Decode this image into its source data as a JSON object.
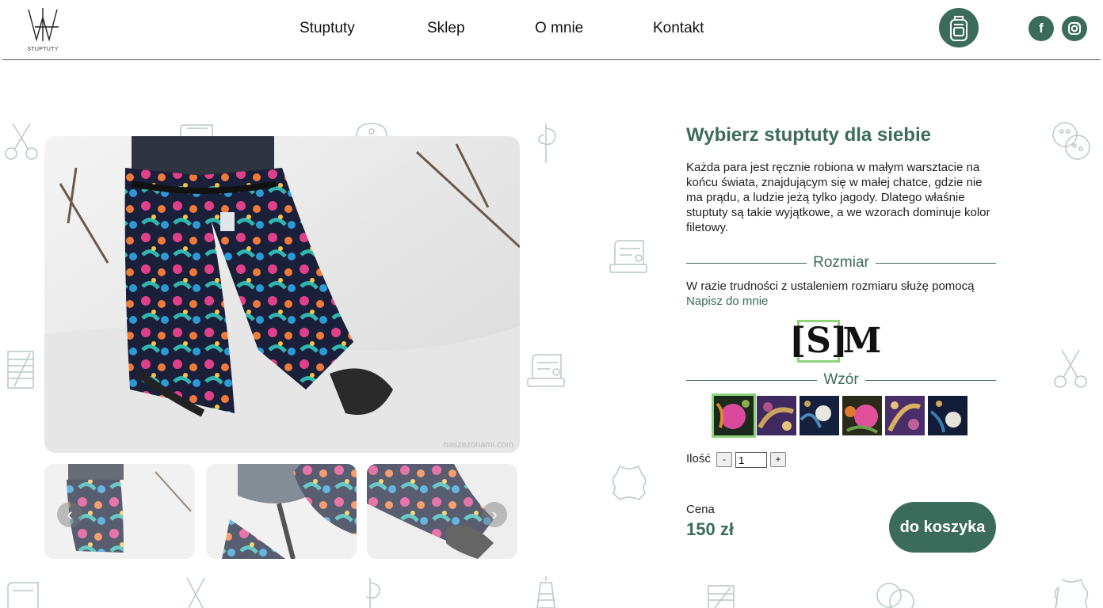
{
  "header": {
    "logo_text": "STUPTUTY",
    "nav": [
      "Stuptuty",
      "Sklep",
      "O mnie",
      "Kontakt"
    ],
    "social": {
      "facebook": "f",
      "instagram": "instagram-icon"
    }
  },
  "gallery": {
    "watermark": "naszezonami.com",
    "prev_arrow": "‹",
    "next_arrow": "›"
  },
  "product": {
    "title": "Wybierz stuptuty dla siebie",
    "description": "Każda para jest ręcznie robiona w małym warsztacie na końcu świata, znajdującym się w małej chatce, gdzie nie ma prądu, a ludzie jeżą tylko jagody. Dlatego właśnie stuptuty są takie wyjątkowe, a we wzorach dominuje kolor filetowy.",
    "size_section": "Rozmiar",
    "size_note": "W razie trudności z ustaleniem rozmiaru służę pomocą",
    "size_note_link": "Napisz do mnie",
    "sizes": [
      "[S]",
      "M"
    ],
    "selected_size": "[S]",
    "pattern_section": "Wzór",
    "quantity_label": "Ilość",
    "qty_minus": "-",
    "qty_plus": "+",
    "quantity_value": "1",
    "price_label": "Cena",
    "price": "150 zł",
    "buy_label": "do koszyka"
  },
  "colors": {
    "brand": "#3b6b5a",
    "selected_outline": "#8fd47c"
  }
}
